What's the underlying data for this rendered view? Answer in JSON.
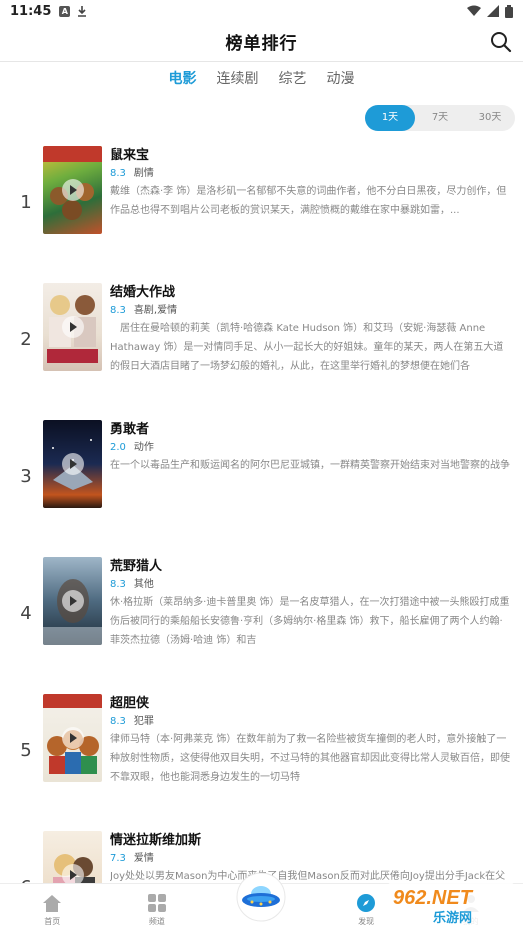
{
  "status_bar": {
    "time": "11:45",
    "badge": "A"
  },
  "header": {
    "title": "榜单排行",
    "search_icon": "search-icon"
  },
  "category_tabs": [
    {
      "label": "电影",
      "active": true
    },
    {
      "label": "连续剧",
      "active": false
    },
    {
      "label": "综艺",
      "active": false
    },
    {
      "label": "动漫",
      "active": false
    }
  ],
  "range_options": [
    {
      "label": "1天",
      "active": true
    },
    {
      "label": "7天",
      "active": false
    },
    {
      "label": "30天",
      "active": false
    }
  ],
  "movies": [
    {
      "rank": "1",
      "title": "鼠来宝",
      "score": "8.3",
      "genre": "剧情",
      "desc": "戴维（杰森·李 饰）是洛杉矶一名郁郁不失意的词曲作者，他不分白日黑夜，尽力创作，但作品总也得不到唱片公司老板的赏识某天，满腔愤概的戴维在家中暴跳如雷，..."
    },
    {
      "rank": "2",
      "title": "结婚大作战",
      "score": "8.3",
      "genre": "喜剧,爱情",
      "desc": "　居住在曼哈顿的莉芙（凯特·哈德森 Kate Hudson 饰）和艾玛（安妮·海瑟薇 Anne Hathaway 饰）是一对情同手足、从小一起长大的好姐妹。童年的某天，两人在第五大道的假日大酒店目睹了一场梦幻般的婚礼，从此，在这里举行婚礼的梦想便在她们各"
    },
    {
      "rank": "3",
      "title": "勇敢者",
      "score": "2.0",
      "genre": "动作",
      "desc": "在一个以毒品生产和贩运闻名的阿尔巴尼亚城镇，一群精英警察开始结束对当地警察的战争"
    },
    {
      "rank": "4",
      "title": "荒野猎人",
      "score": "8.3",
      "genre": "其他",
      "desc": "休·格拉斯（莱昂纳多·迪卡普里奥 饰）是一名皮草猎人，在一次打猎途中被一头熊殴打成重伤后被同行的乘船船长安德鲁·亨利（多姆纳尔·格里森 饰）救下，船长雇佣了两个人约翰·菲茨杰拉德（汤姆·哈迪 饰）和吉"
    },
    {
      "rank": "5",
      "title": "超胆侠",
      "score": "8.3",
      "genre": "犯罪",
      "desc": "律师马特（本·阿弗莱克 饰）在数年前为了救一名险些被货车撞倒的老人时，意外接触了一种放射性物质，这使得他双目失明，不过马特的其他器官却因此变得比常人灵敏百倍，即使不靠双眼，他也能洞悉身边发生的一切马特"
    },
    {
      "rank": "6",
      "title": "情迷拉斯维加斯",
      "score": "7.3",
      "genre": "爱情",
      "desc": "Joy处处以男友Mason为中心而丧失了自我但Mason反而对此厌倦向Joy提出分手Jack在父亲的家具工厂上班但并不努力，对此失望的父亲一怒之下解雇了他两个失意的"
    }
  ],
  "bottom_nav": [
    {
      "label": "首页",
      "icon": "home-icon"
    },
    {
      "label": "频道",
      "icon": "grid-icon"
    },
    {
      "label": "",
      "icon": "ufo-icon"
    },
    {
      "label": "发现",
      "icon": "compass-icon"
    },
    {
      "label": "我的",
      "icon": "user-icon"
    }
  ],
  "watermark": {
    "line1": "962.NET",
    "line2": "乐游网"
  },
  "colors": {
    "accent": "#1e9bd7",
    "watermark_orange": "#f08a1c"
  }
}
